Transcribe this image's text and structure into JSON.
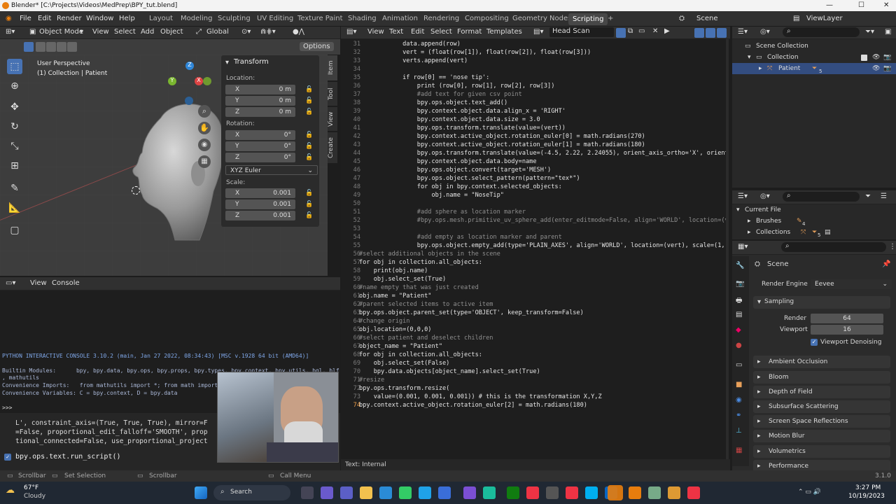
{
  "titlebar": {
    "title": "Blender* [C:\\Projects\\Videos\\MedPrep\\BPY_tut.blend]"
  },
  "menu": {
    "items": [
      "File",
      "Edit",
      "Render",
      "Window",
      "Help"
    ]
  },
  "workspaces": [
    "Layout",
    "Modeling",
    "Sculpting",
    "UV Editing",
    "Texture Paint",
    "Shading",
    "Animation",
    "Rendering",
    "Compositing",
    "Geometry Nodes",
    "Scripting"
  ],
  "scene": {
    "label": "Scene",
    "view_layer": "ViewLayer"
  },
  "viewport": {
    "mode": "Object Mode",
    "menus": [
      "View",
      "Select",
      "Add",
      "Object"
    ],
    "orientation": "Global",
    "options": "Options",
    "overlay_title": "User Perspective",
    "overlay_subtitle": "(1) Collection | Patient",
    "transform": {
      "title": "Transform",
      "location_label": "Location:",
      "location": [
        {
          "k": "X",
          "v": "0 m"
        },
        {
          "k": "Y",
          "v": "0 m"
        },
        {
          "k": "Z",
          "v": "0 m"
        }
      ],
      "rotation_label": "Rotation:",
      "rotation": [
        {
          "k": "X",
          "v": "0°"
        },
        {
          "k": "Y",
          "v": "0°"
        },
        {
          "k": "Z",
          "v": "0°"
        }
      ],
      "rotation_mode": "XYZ Euler",
      "scale_label": "Scale:",
      "scale": [
        {
          "k": "X",
          "v": "0.001"
        },
        {
          "k": "Y",
          "v": "0.001"
        },
        {
          "k": "Z",
          "v": "0.001"
        }
      ]
    },
    "tabs": [
      "Item",
      "Tool",
      "View",
      "Create"
    ]
  },
  "console": {
    "menus": [
      "View",
      "Console"
    ],
    "lines": [
      "PYTHON INTERACTIVE CONSOLE 3.10.2 (main, Jan 27 2022, 08:34:43) [MSC v.1928 64 bit (AMD64)]",
      "",
      "Builtin Modules:      bpy, bpy.data, bpy.ops, bpy.props, bpy.types, bpy.context, bpy.utils, bgl, blf",
      ", mathutils",
      "Convenience Imports:   from mathutils import *; from math import *",
      "Convenience Variables: C = bpy.context, D = bpy.data",
      "",
      ">>> "
    ],
    "info_lines": [
      "L', constraint_axis=(True, True, True), mirror=F",
      "=False, proportional_edit_falloff='SMOOTH', prop",
      "tional_connected=False, use_proportional_project"
    ],
    "last_op": "bpy.ops.text.run_script()"
  },
  "editor": {
    "menus": [
      "View",
      "Text",
      "Edit",
      "Select",
      "Format",
      "Templates"
    ],
    "filename": "Head Scan",
    "status": "Text: Internal",
    "first_line": 31,
    "lines": [
      "            data.append(row)",
      "            vert = (float(row[1]), float(row[2]), float(row[3]))",
      "            verts.append(vert)",
      "",
      "            if row[0] == 'nose tip':",
      "                print (row[0], row[1], row[2], row[3])",
      "                #add text for given csv point",
      "                bpy.ops.object.text_add()",
      "                bpy.context.object.data.align_x = 'RIGHT'",
      "                bpy.context.object.data.size = 3.0",
      "                bpy.ops.transform.translate(value=(vert))",
      "                bpy.context.active_object.rotation_euler[0] = math.radians(270)",
      "                bpy.context.active_object.rotation_euler[1] = math.radians(180)",
      "                bpy.ops.transform.translate(value=(-4.5, 2.22, 2.24055), orient_axis_ortho='X', orient",
      "                bpy.context.object.data.body=name",
      "                bpy.ops.object.convert(target='MESH')",
      "                bpy.ops.object.select_pattern(pattern=\"tex*\")",
      "                for obj in bpy.context.selected_objects:",
      "                    obj.name = \"NoseTip\"",
      "",
      "                #add sphere as location marker",
      "                #bpy.ops.mesh.primitive_uv_sphere_add(enter_editmode=False, align='WORLD', location=(v",
      "",
      "                #add empty as location marker and parent",
      "                bpy.ops.object.empty_add(type='PLAIN_AXES', align='WORLD', location=(vert), scale=(1,",
      "#select additional objects in the scene",
      "for obj in collection.all_objects:",
      "    print(obj.name)",
      "    obj.select_set(True)",
      "#name empty that was just created",
      "obj.name = \"Patient\"",
      "#parent selected items to active item",
      "bpy.ops.object.parent_set(type='OBJECT', keep_transform=False)",
      "#change origin",
      "obj.location=(0,0,0)",
      "#select patient and deselect children",
      "object_name = \"Patient\"",
      "for obj in collection.all_objects:",
      "    obj.select_set(False)",
      "    bpy.data.objects[object_name].select_set(True)",
      "#resize",
      "bpy.ops.transform.resize(",
      "    value=(0.001, 0.001, 0.001)) # this is the transformation X,Y,Z",
      "bpy.context.active_object.rotation_euler[2] = math.radians(180)"
    ]
  },
  "outliner": {
    "rows": [
      "Scene Collection",
      "Collection",
      "Patient"
    ],
    "child_count": "5"
  },
  "blend_data": {
    "rows": [
      "Current File",
      "Brushes",
      "Collections"
    ],
    "counts": [
      "4",
      "5"
    ]
  },
  "properties": {
    "scene": "Scene",
    "render_engine_label": "Render Engine",
    "render_engine": "Eevee",
    "sampling": "Sampling",
    "render_label": "Render",
    "render_value": "64",
    "viewport_label": "Viewport",
    "viewport_value": "16",
    "denoise": "Viewport Denoising",
    "sections": [
      "Ambient Occlusion",
      "Bloom",
      "Depth of Field",
      "Subsurface Scattering",
      "Screen Space Reflections",
      "Motion Blur",
      "Volumetrics",
      "Performance"
    ]
  },
  "footer": {
    "items": [
      "Scrollbar",
      "Set Selection",
      "Scrollbar",
      "Call Menu"
    ],
    "version": "3.1.0"
  },
  "taskbar": {
    "weather_temp": "67°F",
    "weather_desc": "Cloudy",
    "search": "Search",
    "time": "3:27 PM",
    "date": "10/19/2023"
  },
  "colors": {
    "accent": "#4772b3",
    "active_line_number": "#f0a04b",
    "blender_orange": "#e87d0d"
  }
}
